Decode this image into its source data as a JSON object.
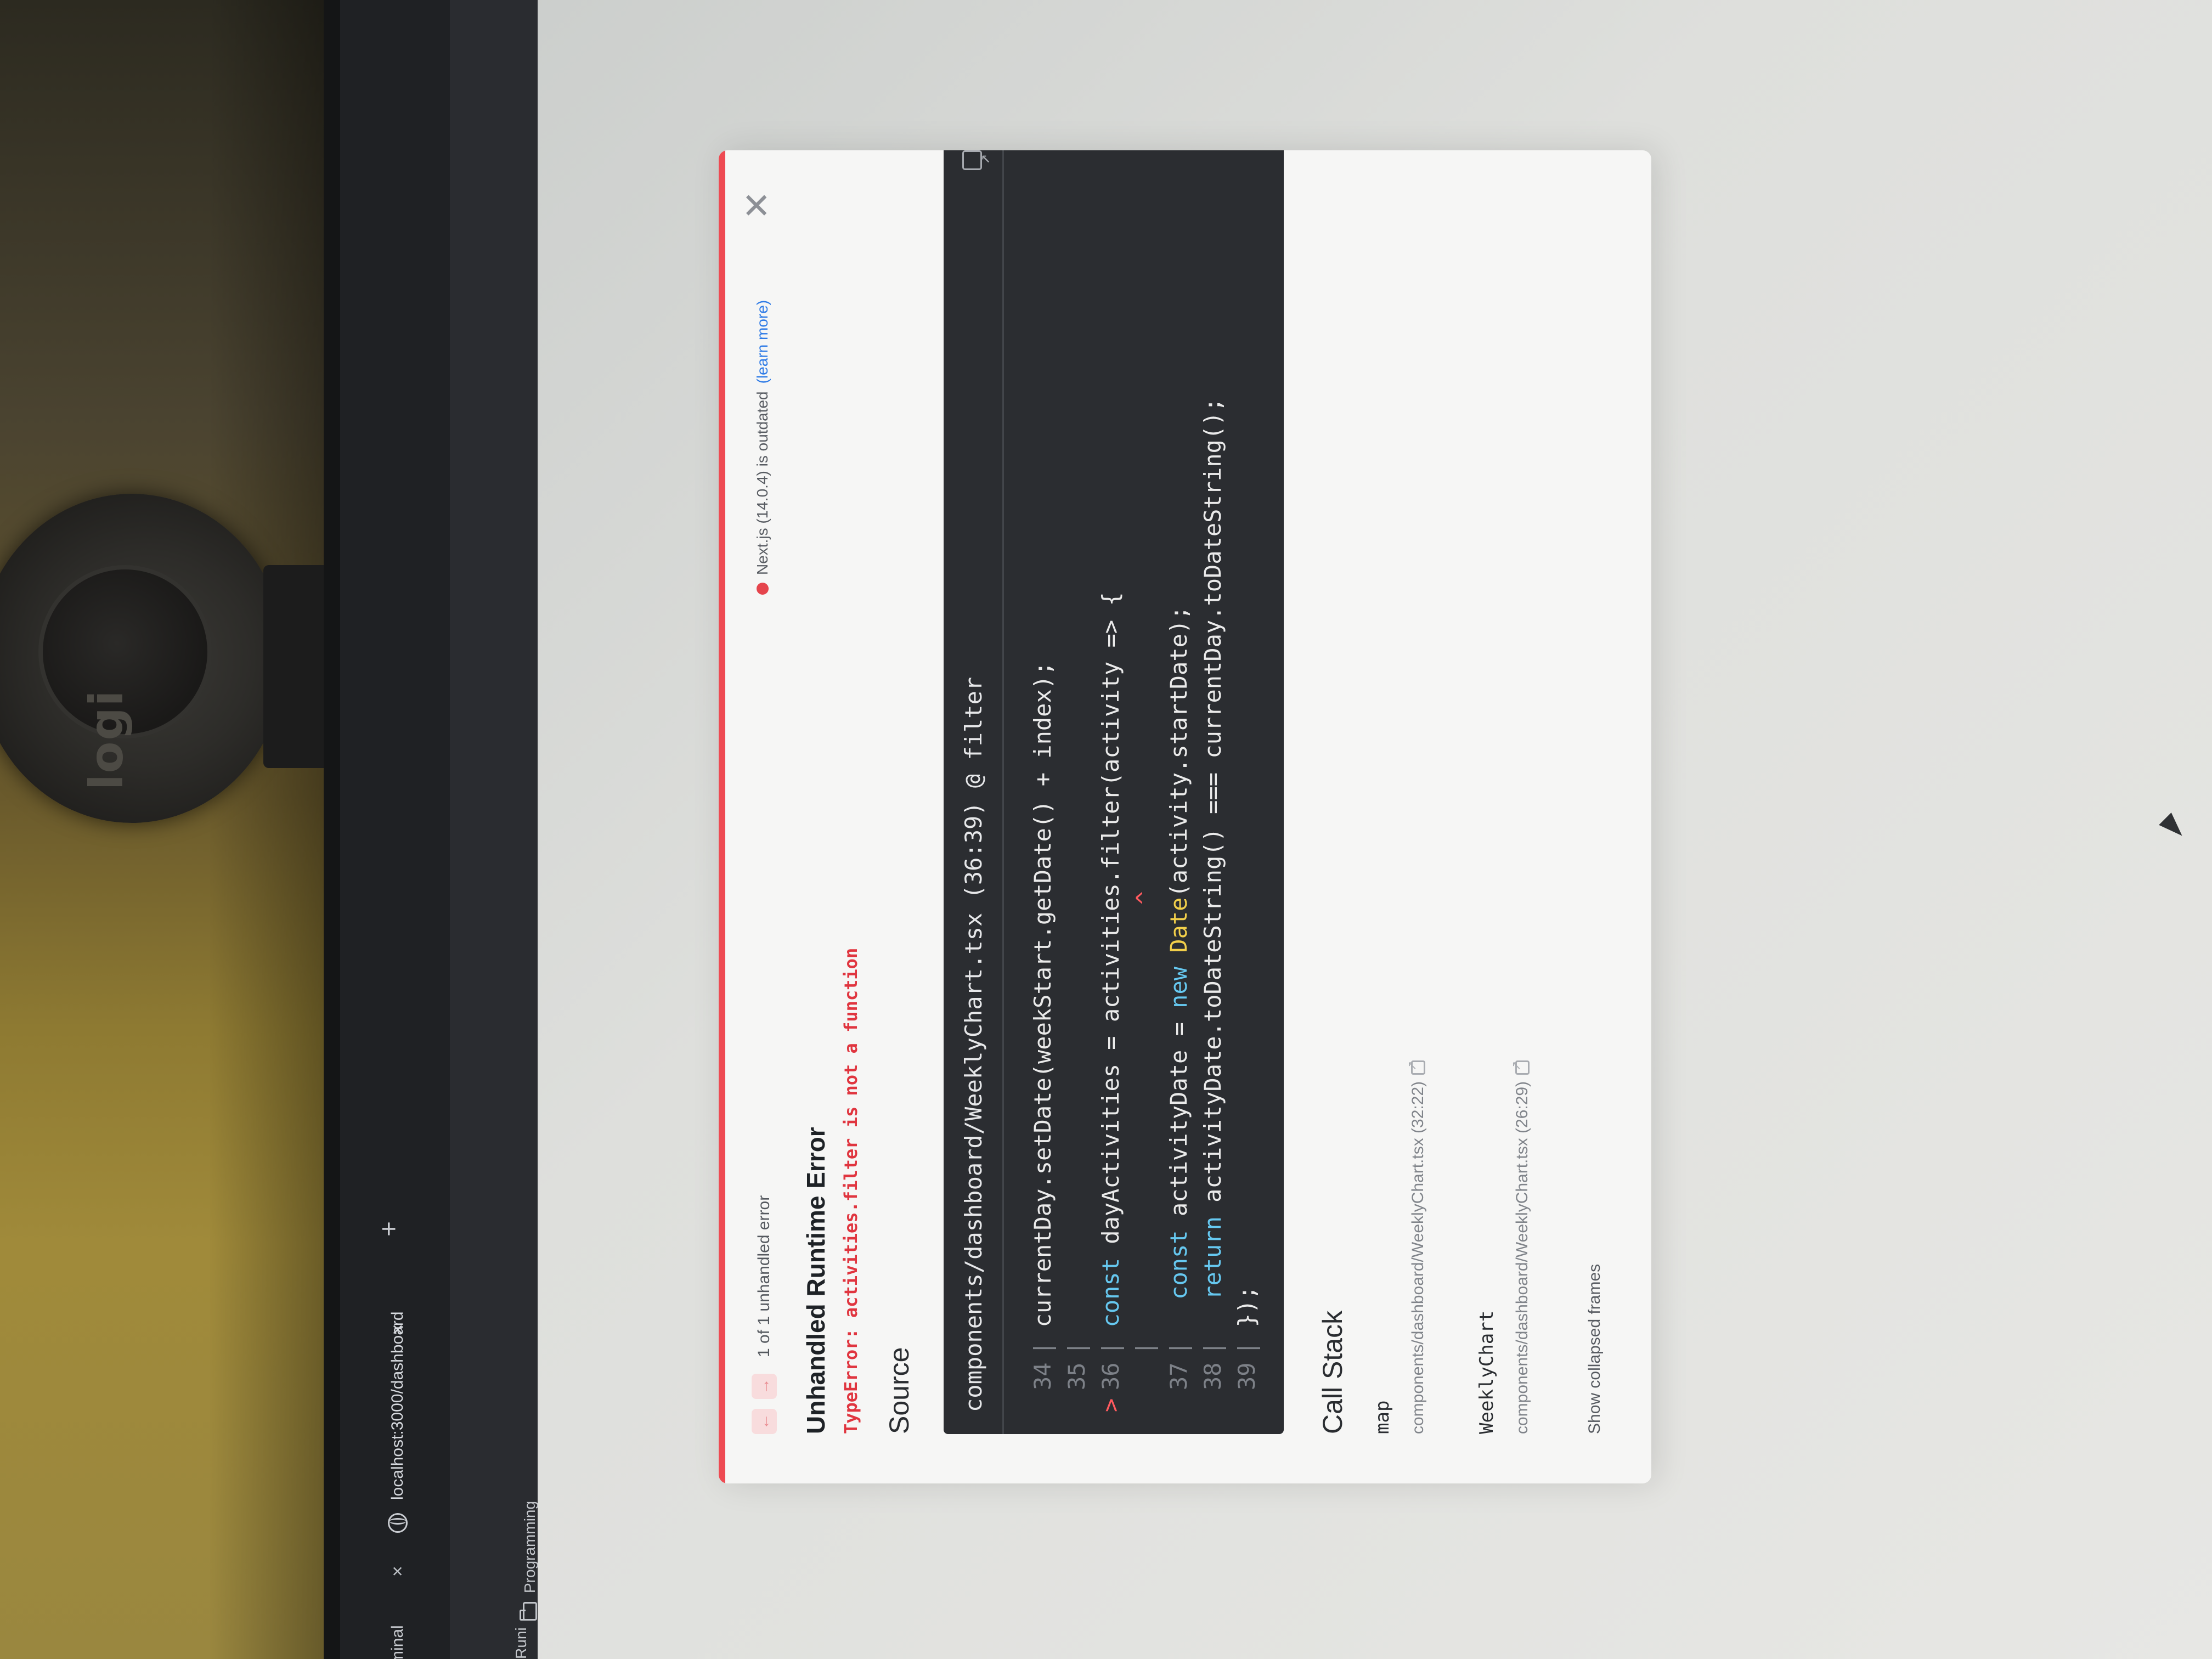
{
  "browser": {
    "tabs": [
      {
        "label": "minal",
        "close": "×"
      },
      {
        "label": "localhost:3000/dashboard",
        "close": "×"
      }
    ],
    "new_tab": "+",
    "bookmarks": [
      {
        "label": "Runi"
      },
      {
        "label": "Programming"
      }
    ]
  },
  "overlay": {
    "nav_prev": "←",
    "nav_next": "→",
    "error_count": "1 of 1 unhandled error",
    "version_text": "Next.js (14.0.4) is outdated",
    "learn_more": "(learn more)",
    "close": "✕",
    "title": "Unhandled Runtime Error",
    "error_type": "TypeError:",
    "error_message": "activities.filter is not a function",
    "source_heading": "Source",
    "code_header": "components/dashboard/WeeklyChart.tsx (36:39) @ filter",
    "call_stack_heading": "Call Stack",
    "frames": [
      {
        "fn": "map",
        "file": "components/dashboard/WeeklyChart.tsx (32:22)"
      },
      {
        "fn": "WeeklyChart",
        "file": "components/dashboard/WeeklyChart.tsx (26:29)"
      }
    ],
    "show_collapsed": "Show collapsed frames"
  },
  "code": {
    "lines": [
      {
        "num": "34",
        "marker": "",
        "text": "currentDay.setDate(weekStart.getDate() + index);"
      },
      {
        "num": "35",
        "marker": "",
        "text": ""
      },
      {
        "num": "36",
        "marker": ">",
        "text": "const dayActivities = activities.filter(activity => {"
      },
      {
        "num": "",
        "marker": "",
        "text": "^"
      },
      {
        "num": "37",
        "marker": "",
        "text": "  const activityDate = new Date(activity.startDate);"
      },
      {
        "num": "38",
        "marker": "",
        "text": "  return activityDate.toDateString() === currentDay.toDateString();"
      },
      {
        "num": "39",
        "marker": "",
        "text": "});"
      }
    ]
  },
  "colors": {
    "accent_red": "#ee4a52",
    "link_blue": "#2f7be6",
    "code_bg": "#2b2d31",
    "keyword": "#66c8f0",
    "type": "#f2cf4a"
  },
  "icons": [
    "globe-icon",
    "folder-icon",
    "open-in-editor-icon",
    "external-link-icon",
    "close-icon",
    "arrow-left-icon",
    "arrow-right-icon"
  ]
}
